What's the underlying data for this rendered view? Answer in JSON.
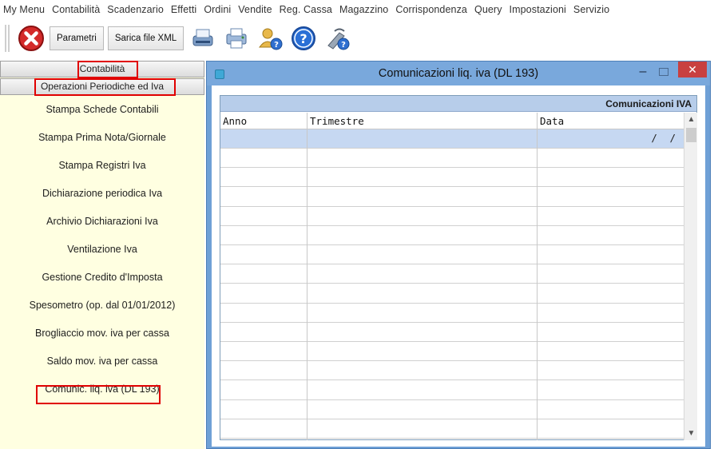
{
  "menu": [
    "My Menu",
    "Contabilità",
    "Scadenzario",
    "Effetti",
    "Ordini",
    "Vendite",
    "Reg. Cassa",
    "Magazzino",
    "Corrispondenza",
    "Query",
    "Impostazioni",
    "Servizio"
  ],
  "toolbar": {
    "close_icon": "close-red-x-icon",
    "parametri_label": "Parametri",
    "xml_label": "Sarica file XML",
    "icons": [
      "scanner-icon",
      "printer-icon",
      "user-help-icon",
      "help-icon",
      "tools-help-icon"
    ]
  },
  "left_panel": {
    "header1": "Contabilità",
    "header2": "Operazioni Periodiche ed Iva",
    "items": [
      {
        "label": "Stampa Schede Contabili"
      },
      {
        "label": "Stampa Prima Nota/Giornale"
      },
      {
        "label": "Stampa Registri Iva"
      },
      {
        "label": "Dichiarazione periodica Iva"
      },
      {
        "label": "Archivio Dichiarazioni Iva"
      },
      {
        "label": "Ventilazione Iva"
      },
      {
        "label": "Gestione Credito d'Imposta"
      },
      {
        "label": "Spesometro (op. dal 01/01/2012)"
      },
      {
        "label": "Brogliaccio mov. iva per cassa"
      },
      {
        "label": "Saldo mov. iva per cassa"
      },
      {
        "label": "Comunic. liq. iva (DL 193)"
      }
    ]
  },
  "dialog": {
    "title": "Comunicazioni liq. iva (DL 193)",
    "minimize": "–",
    "close": "✕",
    "group_title": "Comunicazioni IVA",
    "columns": [
      "Anno",
      "Trimestre",
      "Data"
    ],
    "first_row_date": "/ /",
    "colors": {
      "titlebar": "#79a8dc",
      "selected_row": "#c6d8f2",
      "close_button": "#c84040"
    }
  }
}
